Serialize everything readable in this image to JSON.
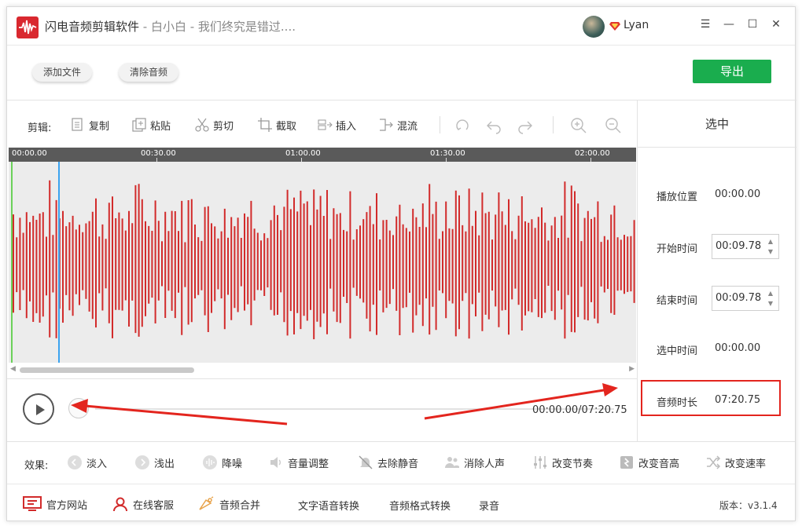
{
  "window": {
    "title": "闪电音频剪辑软件",
    "subtitle": " - 白小白 - 我们终究是错过....",
    "user": "Lyan"
  },
  "top_bar": {
    "add_file": "添加文件",
    "clear_audio": "清除音频",
    "export": "导出"
  },
  "toolbar": {
    "label": "剪辑:",
    "copy": "复制",
    "paste": "粘贴",
    "cut": "剪切",
    "crop": "截取",
    "insert": "插入",
    "mix": "混流"
  },
  "timeline": {
    "ticks": [
      "00:00.00",
      "00:30.00",
      "01:00.00",
      "01:30.00",
      "02:00.00"
    ]
  },
  "player": {
    "time": "00:00.00/07:20.75"
  },
  "panel": {
    "header": "选中",
    "play_position_label": "播放位置",
    "play_position_value": "00:00.00",
    "start_time_label": "开始时间",
    "start_time_value": "00:09.78",
    "end_time_label": "结束时间",
    "end_time_value": "00:09.78",
    "selected_time_label": "选中时间",
    "selected_time_value": "00:00.00",
    "duration_label": "音频时长",
    "duration_value": "07:20.75"
  },
  "effects": {
    "label": "效果:",
    "fade_in": "淡入",
    "fade_out": "浅出",
    "denoise": "降噪",
    "volume": "音量调整",
    "remove_silence": "去除静音",
    "remove_vocals": "消除人声",
    "change_tempo": "改变节奏",
    "change_pitch": "改变音高",
    "change_speed": "改变速率"
  },
  "footer": {
    "website": "官方网站",
    "support": "在线客服",
    "merge": "音频合并",
    "tts": "文字语音转换",
    "format": "音频格式转换",
    "record": "录音",
    "version": "版本：v3.1.4"
  },
  "colors": {
    "waveform": "#d22b2b",
    "export_button": "#1aad4e",
    "highlight_box": "#e3251e",
    "playhead": "#3ba3ef",
    "start_marker": "#6bd15a"
  }
}
